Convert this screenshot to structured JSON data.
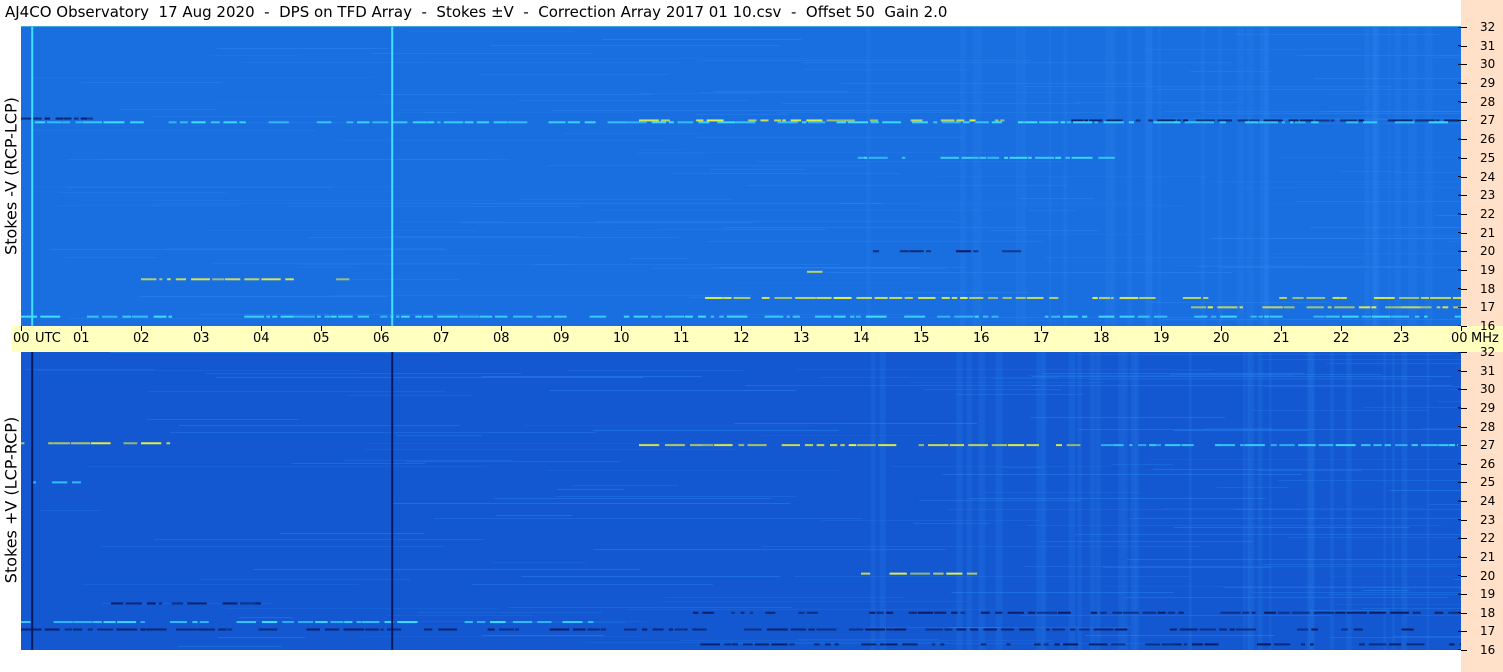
{
  "title": "AJ4CO Observatory  17 Aug 2020  -  DPS on TFD Array  -  Stokes ±V  -  Correction Array 2017 01 10.csv  -  Offset 50  Gain 2.0",
  "colors": {
    "background_blue_top": "#1a6fe0",
    "background_blue_bottom": "#1358d0",
    "noise_light": "#2a86f0",
    "feature_cyan": "#40e0ff",
    "feature_yellow": "#e8f040",
    "feature_dark": "#0a1a60",
    "time_axis_bg": "#ffffc0",
    "freq_strip_bg": "#ffe0c8"
  },
  "chart_data": [
    {
      "type": "heatmap",
      "name_panel": "top",
      "ylabel": "Stokes -V (RCP-LCP)",
      "x_unit": "UTC",
      "y_unit": "MHz",
      "xlim": [
        0,
        24
      ],
      "ylim": [
        16,
        32
      ],
      "x_ticks": [
        "00",
        "01",
        "02",
        "03",
        "04",
        "05",
        "06",
        "07",
        "08",
        "09",
        "10",
        "11",
        "12",
        "13",
        "14",
        "15",
        "16",
        "17",
        "18",
        "19",
        "20",
        "21",
        "22",
        "23",
        "00"
      ],
      "y_ticks": [
        "32",
        "31",
        "30",
        "29",
        "28",
        "27",
        "26",
        "25",
        "24",
        "23",
        "22",
        "21",
        "20",
        "19",
        "18",
        "17",
        "16"
      ],
      "vertical_lines": [
        {
          "utc": 0.17,
          "color": "#40e0ff"
        },
        {
          "utc": 6.17,
          "color": "#40e0ff"
        }
      ],
      "bands": [
        {
          "mhz": 27.1,
          "from": 0.0,
          "to": 1.2,
          "color": "#0a1a60"
        },
        {
          "mhz": 27.0,
          "from": 10.3,
          "to": 16.5,
          "color": "#e8f040"
        },
        {
          "mhz": 27.0,
          "from": 16.5,
          "to": 24.0,
          "color": "#0a1a60"
        },
        {
          "mhz": 26.9,
          "from": 0.0,
          "to": 24.0,
          "color": "#40e0ff"
        },
        {
          "mhz": 25.0,
          "from": 13.8,
          "to": 18.5,
          "color": "#40e0ff"
        },
        {
          "mhz": 20.0,
          "from": 14.2,
          "to": 16.8,
          "color": "#0a1a60"
        },
        {
          "mhz": 18.9,
          "from": 13.1,
          "to": 13.8,
          "color": "#e8f040"
        },
        {
          "mhz": 18.5,
          "from": 2.0,
          "to": 5.5,
          "color": "#e8f040"
        },
        {
          "mhz": 17.5,
          "from": 11.4,
          "to": 24.0,
          "color": "#e8f040"
        },
        {
          "mhz": 17.0,
          "from": 19.5,
          "to": 24.0,
          "color": "#e8f040"
        },
        {
          "mhz": 16.5,
          "from": 0.0,
          "to": 24.0,
          "color": "#40e0ff"
        }
      ]
    },
    {
      "type": "heatmap",
      "name_panel": "bottom",
      "ylabel": "Stokes +V (LCP-RCP)",
      "x_unit": "UTC",
      "y_unit": "MHz",
      "xlim": [
        0,
        24
      ],
      "ylim": [
        16,
        32
      ],
      "x_ticks": [
        "00",
        "01",
        "02",
        "03",
        "04",
        "05",
        "06",
        "07",
        "08",
        "09",
        "10",
        "11",
        "12",
        "13",
        "14",
        "15",
        "16",
        "17",
        "18",
        "19",
        "20",
        "21",
        "22",
        "23",
        "00"
      ],
      "y_ticks": [
        "32",
        "31",
        "30",
        "29",
        "28",
        "27",
        "26",
        "25",
        "24",
        "23",
        "22",
        "21",
        "20",
        "19",
        "18",
        "17",
        "16"
      ],
      "vertical_lines": [
        {
          "utc": 0.17,
          "color": "#0a1a60"
        },
        {
          "utc": 6.17,
          "color": "#0a1a60"
        }
      ],
      "bands": [
        {
          "mhz": 27.1,
          "from": 0.0,
          "to": 2.5,
          "color": "#e8f040"
        },
        {
          "mhz": 27.0,
          "from": 10.3,
          "to": 18.0,
          "color": "#e8f040"
        },
        {
          "mhz": 27.0,
          "from": 18.0,
          "to": 24.0,
          "color": "#40e0ff"
        },
        {
          "mhz": 25.0,
          "from": 0.0,
          "to": 1.0,
          "color": "#40e0ff"
        },
        {
          "mhz": 20.1,
          "from": 14.0,
          "to": 16.0,
          "color": "#e8f040"
        },
        {
          "mhz": 18.5,
          "from": 1.5,
          "to": 4.0,
          "color": "#0a1a60"
        },
        {
          "mhz": 18.0,
          "from": 11.2,
          "to": 24.0,
          "color": "#0a1a60"
        },
        {
          "mhz": 17.5,
          "from": 0.0,
          "to": 10.0,
          "color": "#40e0ff"
        },
        {
          "mhz": 17.1,
          "from": 0.0,
          "to": 24.0,
          "color": "#0a1a60"
        },
        {
          "mhz": 16.3,
          "from": 11.0,
          "to": 24.0,
          "color": "#0a1a60"
        }
      ]
    }
  ],
  "axis": {
    "utc_label": "UTC",
    "mhz_label": "MHz"
  }
}
